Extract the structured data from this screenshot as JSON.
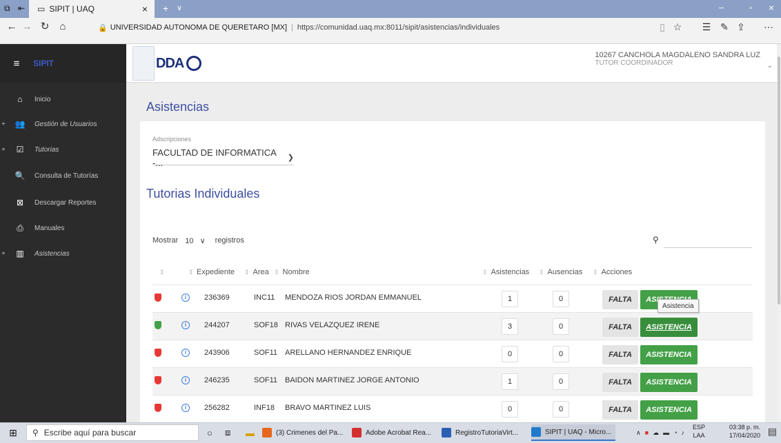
{
  "browser": {
    "tab_title": "SIPIT | UAQ",
    "site_label": "UNIVERSIDAD AUTONOMA DE QUERETARO [MX]",
    "url": "https://comunidad.uaq.mx:8011/sipit/asistencias/individuales"
  },
  "sidebar": {
    "brand": "SIPIT",
    "items": [
      {
        "label": "Inicio",
        "icon": "home-icon",
        "glyph": "⌂"
      },
      {
        "label": "Gestión de Usuarios",
        "icon": "users-icon",
        "glyph": "👥"
      },
      {
        "label": "Tutorias",
        "icon": "checkbox-icon",
        "glyph": "☑"
      },
      {
        "label": "Consulta de Tutorías",
        "icon": "search-icon",
        "glyph": "🔍"
      },
      {
        "label": "Descargar Reportes",
        "icon": "excel-file-icon",
        "glyph": "⊠"
      },
      {
        "label": "Manuales",
        "icon": "pdf-file-icon",
        "glyph": "⎙"
      },
      {
        "label": "Asistencias",
        "icon": "chart-icon",
        "glyph": "▥"
      }
    ]
  },
  "header": {
    "logo_text": "DDA",
    "logo_sub": "UAQ",
    "user_name": "10267 CANCHOLA MAGDALENO SANDRA LUZ",
    "user_role": "TUTOR COORDINADOR"
  },
  "main": {
    "title": "Asistencias",
    "adscripciones_label": "Adscripciones",
    "adscripcion_value": "FACULTAD DE INFORMATICA -...",
    "subtitle": "Tutorias Individuales",
    "mostrar_label": "Mostrar",
    "page_length": "10",
    "registros_label": "registros",
    "search_placeholder": "",
    "columns": {
      "expediente": "Expediente",
      "area": "Area",
      "nombre": "Nombre",
      "asistencias": "Asistencias",
      "ausencias": "Ausencias",
      "acciones": "Acciones"
    },
    "falta_label": "FALTA",
    "asistencia_label": "ASISTENCIA",
    "tooltip": "Asistencia",
    "rows": [
      {
        "status": "red",
        "expediente": "236369",
        "area": "INC11",
        "nombre": "MENDOZA RIOS JORDAN EMMANUEL",
        "asistencias": "1",
        "ausencias": "0"
      },
      {
        "status": "green",
        "expediente": "244207",
        "area": "SOF18",
        "nombre": "RIVAS VELAZQUEZ IRENE",
        "asistencias": "3",
        "ausencias": "0"
      },
      {
        "status": "red",
        "expediente": "243906",
        "area": "SOF11",
        "nombre": "ARELLANO HERNANDEZ ENRIQUE",
        "asistencias": "0",
        "ausencias": "0"
      },
      {
        "status": "red",
        "expediente": "246235",
        "area": "SOF11",
        "nombre": "BAIDON MARTINEZ JORGE ANTONIO",
        "asistencias": "1",
        "ausencias": "0"
      },
      {
        "status": "red",
        "expediente": "256282",
        "area": "INF18",
        "nombre": "BRAVO MARTINEZ LUIS",
        "asistencias": "0",
        "ausencias": "0"
      }
    ]
  },
  "taskbar": {
    "search_placeholder": "Escribe aquí para buscar",
    "apps": [
      {
        "label": "(3) Crimenes del Pa...",
        "color": "#e6681f"
      },
      {
        "label": "Adobe Acrobat Rea...",
        "color": "#d32f2f"
      },
      {
        "label": "RegistroTutoriaVirt...",
        "color": "#2b5fb4"
      },
      {
        "label": "SIPIT | UAQ - Micro...",
        "color": "#1f7acb"
      }
    ],
    "lang": "ESP",
    "lang_sub": "LAA",
    "time": "03:38 p. m.",
    "date": "17/04/2020"
  },
  "colors": {
    "accent": "#3d4fa0",
    "success": "#43a047",
    "danger": "#e53935",
    "sidebar_bg": "#2b2b2b"
  }
}
